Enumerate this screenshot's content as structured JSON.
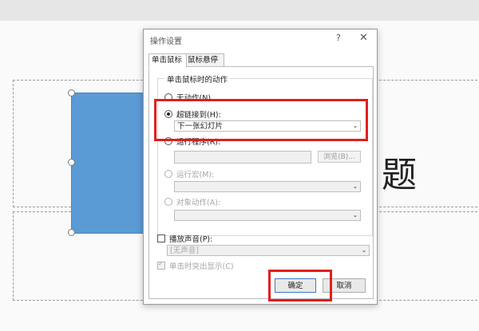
{
  "slide": {
    "title_char": "题"
  },
  "dialog": {
    "title": "操作设置",
    "help": "?",
    "close": "✕",
    "tabs": [
      "单击鼠标",
      "鼠标悬停"
    ],
    "group_label": "单击鼠标时的动作",
    "option_none": "无动作(N)",
    "option_hyperlink": "超链接到(H):",
    "hyperlink_value": "下一张幻灯片",
    "option_run_program": "运行程序(R):",
    "run_program_value": "",
    "browse_label": "浏览(B)...",
    "option_run_macro": "运行宏(M):",
    "macro_value": "",
    "option_object_action": "对象动作(A):",
    "object_action_value": "",
    "play_sound_label": "播放声音(P):",
    "sound_value": "[无声音]",
    "highlight_click_label": "单击时突出显示(C)",
    "ok_label": "确定",
    "cancel_label": "取消",
    "dropdown_arrow": "⌄"
  },
  "colors": {
    "shape_fill": "#5b9bd5",
    "highlight": "#e01e1e"
  }
}
